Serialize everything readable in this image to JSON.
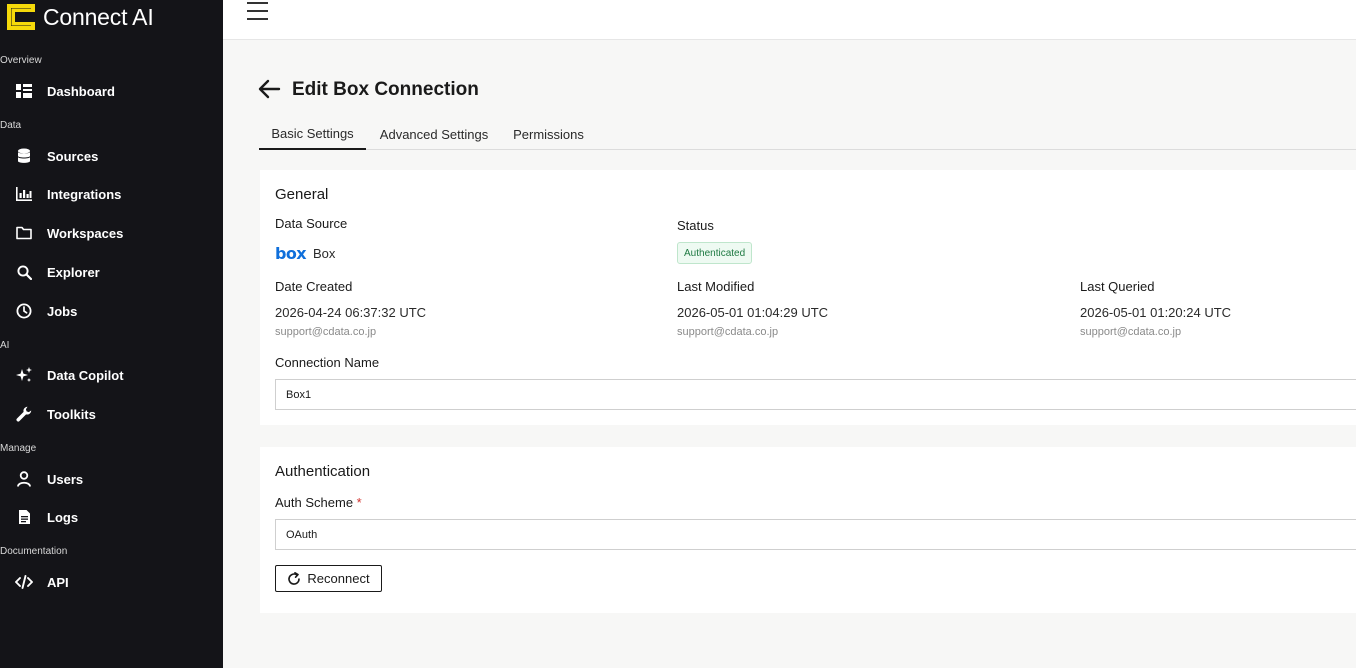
{
  "brand": {
    "name": "Connect AI",
    "accent": "#f5d90a"
  },
  "sidebar": {
    "sections": [
      {
        "label": "Overview"
      },
      {
        "label": "Data"
      },
      {
        "label": "AI"
      },
      {
        "label": "Manage"
      },
      {
        "label": "Documentation"
      }
    ],
    "items": [
      {
        "label": "Dashboard",
        "icon": "dashboard-icon"
      },
      {
        "label": "Sources",
        "icon": "database-icon"
      },
      {
        "label": "Integrations",
        "icon": "bar-chart-icon"
      },
      {
        "label": "Workspaces",
        "icon": "folder-icon"
      },
      {
        "label": "Explorer",
        "icon": "search-icon"
      },
      {
        "label": "Jobs",
        "icon": "clock-icon"
      },
      {
        "label": "Data Copilot",
        "icon": "sparkles-icon"
      },
      {
        "label": "Toolkits",
        "icon": "wrench-icon"
      },
      {
        "label": "Users",
        "icon": "user-icon"
      },
      {
        "label": "Logs",
        "icon": "document-icon"
      },
      {
        "label": "API",
        "icon": "code-icon"
      }
    ]
  },
  "header": {
    "title": "Edit Box Connection"
  },
  "tabs": [
    {
      "label": "Basic Settings",
      "active": true
    },
    {
      "label": "Advanced Settings",
      "active": false
    },
    {
      "label": "Permissions",
      "active": false
    }
  ],
  "general": {
    "title": "General",
    "data_source_label": "Data Source",
    "data_source_logo": "box",
    "data_source_value": "Box",
    "status_label": "Status",
    "status_value": "Authenticated",
    "date_created_label": "Date Created",
    "date_created_value": "2026-04-24 06:37:32 UTC",
    "date_created_by": "support@cdata.co.jp",
    "last_modified_label": "Last Modified",
    "last_modified_value": "2026-05-01 01:04:29 UTC",
    "last_modified_by": "support@cdata.co.jp",
    "last_queried_label": "Last Queried",
    "last_queried_value": "2026-05-01 01:20:24 UTC",
    "last_queried_by": "support@cdata.co.jp",
    "connection_name_label": "Connection Name",
    "connection_name_value": "Box1"
  },
  "authentication": {
    "title": "Authentication",
    "auth_scheme_label": "Auth Scheme",
    "required_mark": "*",
    "auth_scheme_value": "OAuth",
    "reconnect_label": "Reconnect"
  }
}
